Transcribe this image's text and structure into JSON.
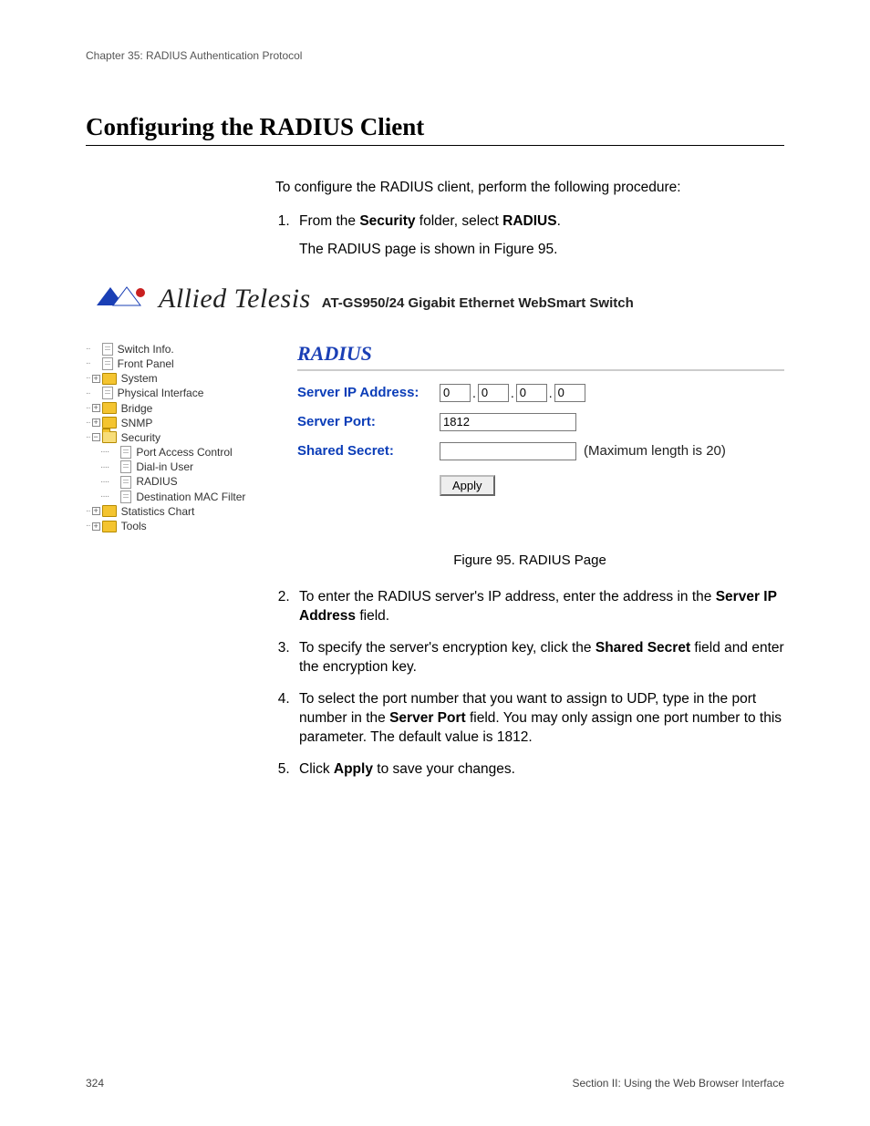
{
  "chapter": "Chapter 35: RADIUS Authentication Protocol",
  "heading": "Configuring the RADIUS Client",
  "intro": "To configure the RADIUS client, perform the following procedure:",
  "steps": {
    "s1_a": "From the ",
    "s1_b": "Security",
    "s1_c": " folder, select ",
    "s1_d": "RADIUS",
    "s1_e": ".",
    "s1_after": "The RADIUS page is shown in Figure 95.",
    "s2_a": "To enter the RADIUS server's IP address, enter the address in the ",
    "s2_b": "Server IP Address",
    "s2_c": " field.",
    "s3_a": "To specify the server's encryption key, click the ",
    "s3_b": "Shared Secret",
    "s3_c": " field and enter the encryption key.",
    "s4_a": "To select the port number that you want to assign to UDP, type in the port number in the ",
    "s4_b": "Server Port",
    "s4_c": " field. You may only assign one port number to this parameter. The default value is 1812.",
    "s5_a": "Click ",
    "s5_b": "Apply",
    "s5_c": " to save your changes."
  },
  "figure_caption": "Figure 95. RADIUS Page",
  "brand": {
    "word": "Allied Telesis",
    "sub": "AT-GS950/24 Gigabit Ethernet WebSmart Switch"
  },
  "panel": {
    "title": "RADIUS",
    "labels": {
      "ip": "Server IP Address:",
      "port": "Server Port:",
      "secret": "Shared Secret:"
    },
    "ip": [
      "0",
      "0",
      "0",
      "0"
    ],
    "port": "1812",
    "secret": "",
    "maxlen": "(Maximum length is 20)",
    "apply": "Apply"
  },
  "tree": {
    "items": [
      {
        "indent": 0,
        "exp": "none",
        "icon": "page",
        "label": "Switch Info."
      },
      {
        "indent": 0,
        "exp": "none",
        "icon": "page",
        "label": "Front Panel"
      },
      {
        "indent": 0,
        "exp": "plus",
        "icon": "folder-closed",
        "label": "System"
      },
      {
        "indent": 0,
        "exp": "none",
        "icon": "page",
        "label": "Physical Interface"
      },
      {
        "indent": 0,
        "exp": "plus",
        "icon": "folder-closed",
        "label": "Bridge"
      },
      {
        "indent": 0,
        "exp": "plus",
        "icon": "folder-closed",
        "label": "SNMP"
      },
      {
        "indent": 0,
        "exp": "minus",
        "icon": "folder-open",
        "label": "Security"
      },
      {
        "indent": 1,
        "exp": "none",
        "icon": "page",
        "label": "Port Access Control"
      },
      {
        "indent": 1,
        "exp": "none",
        "icon": "page",
        "label": "Dial-in User"
      },
      {
        "indent": 1,
        "exp": "none",
        "icon": "page",
        "label": "RADIUS"
      },
      {
        "indent": 1,
        "exp": "none",
        "icon": "page",
        "label": "Destination MAC Filter"
      },
      {
        "indent": 0,
        "exp": "plus",
        "icon": "folder-closed",
        "label": "Statistics Chart"
      },
      {
        "indent": 0,
        "exp": "plus",
        "icon": "folder-closed",
        "label": "Tools"
      }
    ]
  },
  "footer": {
    "left": "324",
    "right": "Section II: Using the Web Browser Interface"
  }
}
